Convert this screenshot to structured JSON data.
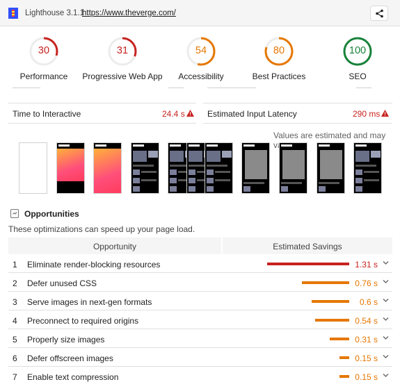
{
  "header": {
    "app_title": "Lighthouse 3.1.1",
    "url": "https://www.theverge.com/",
    "share_icon": "share-icon"
  },
  "gauges": [
    {
      "score": "30",
      "label": "Performance",
      "value": 30,
      "color": "#c7221f"
    },
    {
      "score": "31",
      "label": "Progressive Web App",
      "value": 31,
      "color": "#c7221f"
    },
    {
      "score": "54",
      "label": "Accessibility",
      "value": 54,
      "color": "#e67700"
    },
    {
      "score": "80",
      "label": "Best Practices",
      "value": 80,
      "color": "#e67700"
    },
    {
      "score": "100",
      "label": "SEO",
      "value": 100,
      "color": "#178239"
    }
  ],
  "metrics": [
    {
      "name": "Time to Interactive",
      "value": "24.4 s",
      "status": "warning"
    },
    {
      "name": "Estimated Input Latency",
      "value": "290 ms",
      "status": "warning"
    }
  ],
  "disclaimer": "Values are estimated and may vary.",
  "opportunities": {
    "title": "Opportunities",
    "description": "These optimizations can speed up your page load.",
    "col_opportunity": "Opportunity",
    "col_savings": "Estimated Savings",
    "rows": [
      {
        "num": "1",
        "name": "Eliminate render-blocking resources",
        "savings": "1.31 s",
        "savings_value": 1.31,
        "color": "#c7221f"
      },
      {
        "num": "2",
        "name": "Defer unused CSS",
        "savings": "0.76 s",
        "savings_value": 0.76,
        "color": "#e67700"
      },
      {
        "num": "3",
        "name": "Serve images in next-gen formats",
        "savings": "0.6 s",
        "savings_value": 0.6,
        "color": "#e67700"
      },
      {
        "num": "4",
        "name": "Preconnect to required origins",
        "savings": "0.54 s",
        "savings_value": 0.54,
        "color": "#e67700"
      },
      {
        "num": "5",
        "name": "Properly size images",
        "savings": "0.31 s",
        "savings_value": 0.31,
        "color": "#e67700"
      },
      {
        "num": "6",
        "name": "Defer offscreen images",
        "savings": "0.15 s",
        "savings_value": 0.15,
        "color": "#e67700"
      },
      {
        "num": "7",
        "name": "Enable text compression",
        "savings": "0.15 s",
        "savings_value": 0.15,
        "color": "#e67700"
      }
    ]
  }
}
